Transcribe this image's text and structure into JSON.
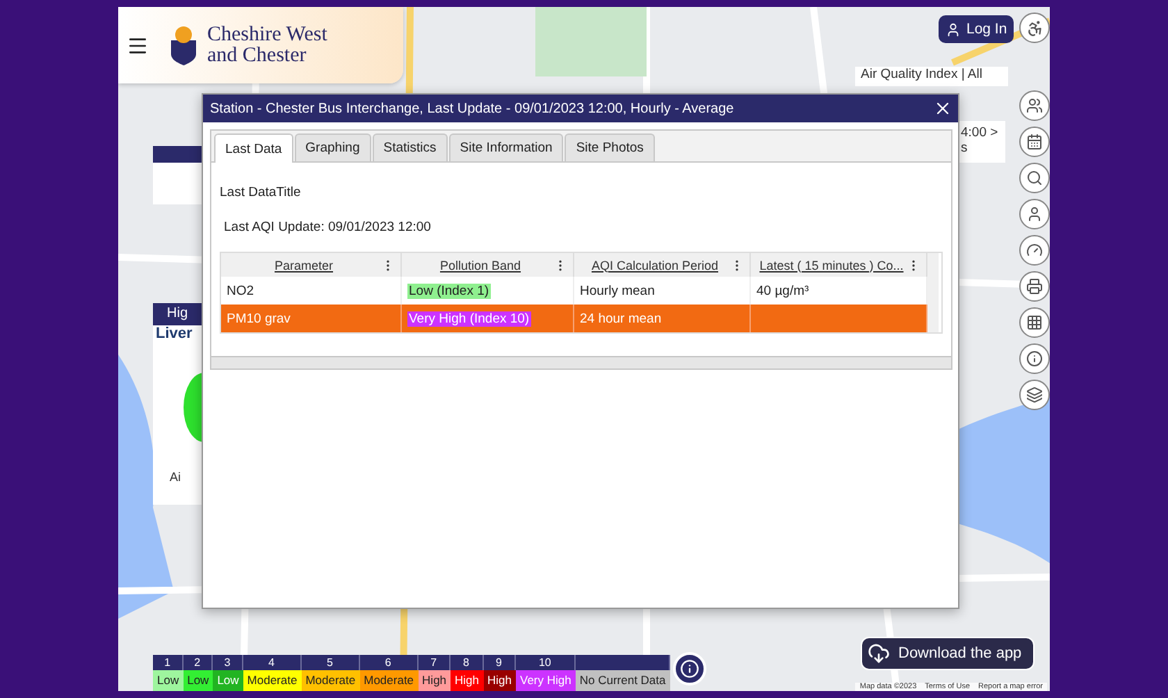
{
  "header": {
    "logo_line_1": "Cheshire West",
    "logo_line_2": "and Chester",
    "login": "Log In"
  },
  "map_overlays": {
    "index_bar": "Air Quality Index | All",
    "time_card": {
      "line_1": "4:00 >",
      "line_2": "s"
    },
    "site_card": {
      "heading": "Hig",
      "title": "Liver",
      "caption": "Ai"
    }
  },
  "dialog": {
    "title": "Station - Chester Bus Interchange, Last Update - 09/01/2023 12:00, Hourly - Average",
    "tabs": [
      {
        "label": "Last Data",
        "selected": true
      },
      {
        "label": "Graphing",
        "selected": false
      },
      {
        "label": "Statistics",
        "selected": false
      },
      {
        "label": "Site Information",
        "selected": false
      },
      {
        "label": "Site Photos",
        "selected": false
      }
    ],
    "heading": "Last DataTitle",
    "update": "Last AQI Update: 09/01/2023 12:00",
    "table": {
      "columns": [
        "Parameter",
        "Pollution Band",
        "AQI Calculation Period",
        "Latest ( 15 minutes ) Co..."
      ],
      "rows": [
        {
          "parameter": "NO2",
          "band": "Low (Index 1)",
          "color": "#8ff08f",
          "period": "Hourly mean",
          "latest": "40 µg/m³",
          "selected": false
        },
        {
          "parameter": "PM10 grav",
          "band": "Very High (Index 10)",
          "color": "#cc33ff",
          "period": "24 hour mean",
          "latest": "",
          "selected": true
        }
      ]
    }
  },
  "legend": [
    {
      "index": "1",
      "label": "Low",
      "color": "#9ef59e"
    },
    {
      "index": "2",
      "label": "Low",
      "color": "#33ee33"
    },
    {
      "index": "3",
      "label": "Low",
      "color": "#22b422"
    },
    {
      "index": "4",
      "label": "Moderate",
      "color": "#ffff00"
    },
    {
      "index": "5",
      "label": "Moderate",
      "color": "#ffc000"
    },
    {
      "index": "6",
      "label": "Moderate",
      "color": "#ff9900"
    },
    {
      "index": "7",
      "label": "High",
      "color": "#ff9a9a"
    },
    {
      "index": "8",
      "label": "High",
      "color": "#ff0000"
    },
    {
      "index": "9",
      "label": "High",
      "color": "#990000"
    },
    {
      "index": "10",
      "label": "Very High",
      "color": "#cc33ff"
    },
    {
      "label": "No Current Data",
      "color": "#c0c0c0"
    }
  ],
  "download_button": "Download the app",
  "attribution": [
    "Map data ©2023",
    "Terms of Use",
    "Report a map error"
  ]
}
